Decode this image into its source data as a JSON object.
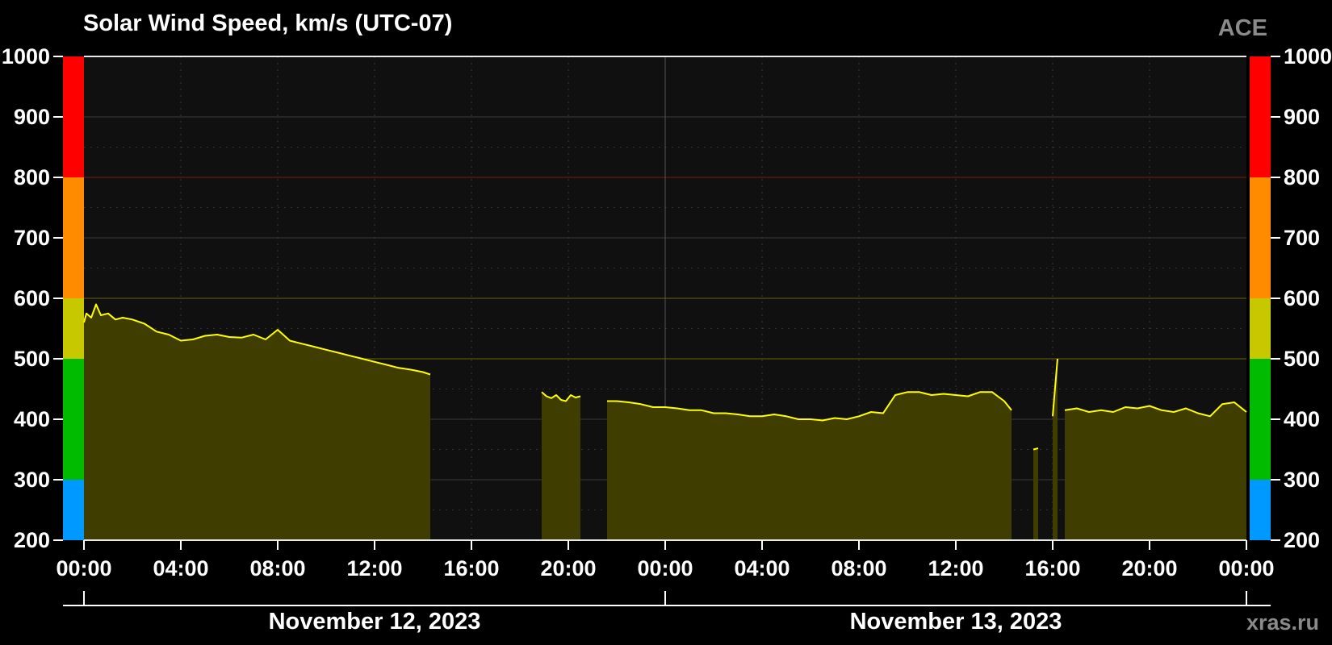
{
  "chart_data": {
    "type": "area",
    "title": "Solar Wind Speed, km/s (UTC-07)",
    "source": "ACE",
    "credit": "xras.ru",
    "ylim": [
      200,
      1000
    ],
    "y_ticks": [
      "200",
      "300",
      "400",
      "500",
      "600",
      "700",
      "800",
      "900",
      "1000"
    ],
    "x_range_hours": [
      0,
      48
    ],
    "x_ticks": [
      "00:00",
      "04:00",
      "08:00",
      "12:00",
      "16:00",
      "20:00",
      "00:00",
      "04:00",
      "08:00",
      "12:00",
      "16:00",
      "20:00",
      "00:00"
    ],
    "dates": [
      "November 12, 2023",
      "November 13, 2023"
    ],
    "grid": true,
    "threshold_bands": [
      {
        "from": 200,
        "to": 300,
        "color": "#0099ff"
      },
      {
        "from": 300,
        "to": 500,
        "color": "#00bb00"
      },
      {
        "from": 500,
        "to": 600,
        "color": "#c8c800"
      },
      {
        "from": 600,
        "to": 800,
        "color": "#ff8c00"
      },
      {
        "from": 800,
        "to": 1000,
        "color": "#ff0000"
      }
    ],
    "colors": {
      "line": "#ffff00",
      "fill": "#3f3d00",
      "plot_bg": "#101010",
      "grid": "#3a3a3a"
    },
    "series": [
      {
        "segments": [
          {
            "x": [
              0,
              0.1,
              0.3,
              0.5,
              0.7,
              1.0,
              1.3,
              1.6,
              2.0,
              2.5,
              3.0,
              3.5,
              4.0,
              4.5,
              5.0,
              5.5,
              6.0,
              6.5,
              7.0,
              7.5,
              8.0,
              8.5,
              9.0,
              9.5,
              10.0,
              10.5,
              11.0,
              11.5,
              12.0,
              12.5,
              13.0,
              13.5,
              14.0,
              14.3
            ],
            "y": [
              560,
              575,
              568,
              590,
              572,
              575,
              565,
              568,
              565,
              558,
              545,
              540,
              530,
              532,
              538,
              540,
              536,
              535,
              540,
              532,
              548,
              530,
              525,
              520,
              515,
              510,
              505,
              500,
              495,
              490,
              485,
              482,
              478,
              474
            ]
          },
          {
            "x": [
              18.9,
              19.1,
              19.3,
              19.5,
              19.7,
              19.9,
              20.1,
              20.3,
              20.5
            ],
            "y": [
              445,
              438,
              435,
              440,
              432,
              430,
              440,
              436,
              438
            ]
          },
          {
            "x": [
              21.6,
              22.0,
              22.5,
              23.0,
              23.5,
              24.0,
              24.5,
              25.0,
              25.5,
              26.0,
              26.5,
              27.0,
              27.5,
              28.0,
              28.5,
              29.0,
              29.5,
              30.0,
              30.5,
              31.0,
              31.5,
              32.0,
              32.5,
              33.0,
              33.5,
              34.0,
              34.5,
              35.0,
              35.5,
              36.0,
              36.5,
              37.0,
              37.5,
              38.0,
              38.3
            ],
            "y": [
              430,
              430,
              428,
              425,
              420,
              420,
              418,
              415,
              415,
              410,
              410,
              408,
              405,
              405,
              408,
              405,
              400,
              400,
              398,
              402,
              400,
              405,
              412,
              410,
              440,
              445,
              445,
              440,
              442,
              440,
              438,
              445,
              445,
              430,
              415
            ]
          },
          {
            "x": [
              39.2,
              39.4
            ],
            "y": [
              350,
              352
            ]
          },
          {
            "x": [
              40.0,
              40.2
            ],
            "y": [
              405,
              500
            ]
          },
          {
            "x": [
              40.5,
              41.0,
              41.5,
              42.0,
              42.5,
              43.0,
              43.5,
              44.0,
              44.5,
              45.0,
              45.5,
              46.0,
              46.5,
              47.0,
              47.5,
              48.0
            ],
            "y": [
              415,
              418,
              412,
              415,
              412,
              420,
              418,
              422,
              415,
              412,
              418,
              410,
              405,
              425,
              428,
              412
            ]
          }
        ]
      }
    ]
  }
}
